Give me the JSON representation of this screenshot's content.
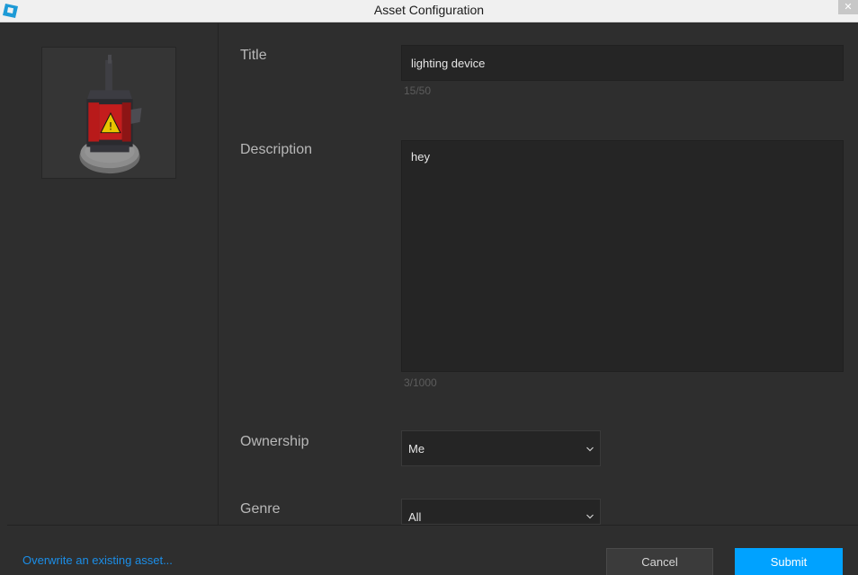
{
  "window": {
    "title": "Asset Configuration",
    "close_glyph": "✕"
  },
  "icons": {
    "app": "roblox-studio-icon",
    "close": "close-icon",
    "chevron": "chevron-down-icon"
  },
  "colors": {
    "accent": "#00a2ff",
    "link": "#1b8ee8",
    "background": "#2e2e2e",
    "field": "#252525"
  },
  "form": {
    "title": {
      "label": "Title",
      "value": "lighting device",
      "counter": "15/50"
    },
    "description": {
      "label": "Description",
      "value": "hey",
      "counter": "3/1000"
    },
    "ownership": {
      "label": "Ownership",
      "value": "Me"
    },
    "genre": {
      "label": "Genre",
      "value": "All"
    }
  },
  "footer": {
    "overwrite_link": "Overwrite an existing asset...",
    "cancel_label": "Cancel",
    "submit_label": "Submit"
  }
}
